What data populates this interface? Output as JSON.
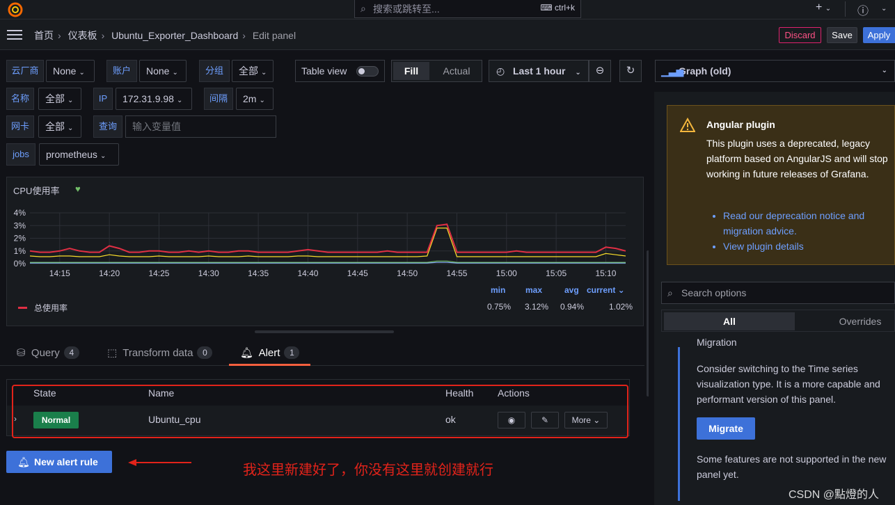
{
  "topbar": {
    "search_placeholder": "搜索或跳转至...",
    "search_shortcut": "ctrl+k",
    "plus_icon": "plus-icon",
    "help_icon": "help-icon"
  },
  "breadcrumb": [
    "首页",
    "仪表板",
    "Ubuntu_Exporter_Dashboard",
    "Edit panel"
  ],
  "actions": {
    "discard": "Discard",
    "save": "Save",
    "apply": "Apply"
  },
  "variables": {
    "cloud": {
      "label": "云厂商",
      "value": "None"
    },
    "account": {
      "label": "账户",
      "value": "None"
    },
    "group": {
      "label": "分组",
      "value": "全部"
    },
    "name": {
      "label": "名称",
      "value": "全部"
    },
    "ip": {
      "label": "IP",
      "value": "172.31.9.98"
    },
    "interval": {
      "label": "间隔",
      "value": "2m"
    },
    "nic": {
      "label": "网卡",
      "value": "全部"
    },
    "query": {
      "label": "查询",
      "placeholder": "输入变量值"
    },
    "jobs": {
      "label": "jobs",
      "value": "prometheus"
    }
  },
  "controls": {
    "table_view": "Table view",
    "fill": "Fill",
    "actual": "Actual",
    "time_range": "Last 1 hour"
  },
  "panel": {
    "title": "CPU使用率",
    "legend_headers": [
      "min",
      "max",
      "avg",
      "current"
    ],
    "legend_series": "总使用率",
    "legend_values": [
      "0.75%",
      "3.12%",
      "0.94%",
      "1.02%"
    ]
  },
  "chart_data": {
    "type": "line",
    "title": "CPU使用率",
    "x": [
      "14:12",
      "14:13",
      "14:14",
      "14:15",
      "14:16",
      "14:17",
      "14:18",
      "14:19",
      "14:20",
      "14:21",
      "14:22",
      "14:23",
      "14:24",
      "14:25",
      "14:26",
      "14:27",
      "14:28",
      "14:29",
      "14:30",
      "14:31",
      "14:32",
      "14:33",
      "14:34",
      "14:35",
      "14:36",
      "14:37",
      "14:38",
      "14:39",
      "14:40",
      "14:41",
      "14:42",
      "14:43",
      "14:44",
      "14:45",
      "14:46",
      "14:47",
      "14:48",
      "14:49",
      "14:50",
      "14:51",
      "14:52",
      "14:53",
      "14:54",
      "14:55",
      "14:56",
      "14:57",
      "14:58",
      "14:59",
      "15:00",
      "15:01",
      "15:02",
      "15:03",
      "15:04",
      "15:05",
      "15:06",
      "15:07",
      "15:08",
      "15:09",
      "15:10",
      "15:11",
      "15:12"
    ],
    "x_ticks": [
      "14:15",
      "14:20",
      "14:25",
      "14:30",
      "14:35",
      "14:40",
      "14:45",
      "14:50",
      "14:55",
      "15:00",
      "15:05",
      "15:10"
    ],
    "y_ticks": [
      "0%",
      "1%",
      "2%",
      "3%",
      "4%"
    ],
    "ylim": [
      0,
      4
    ],
    "series": [
      {
        "name": "总使用率",
        "color": "#e02f44",
        "values": [
          1.0,
          0.9,
          0.9,
          1.0,
          1.2,
          1.0,
          0.9,
          0.9,
          1.4,
          1.2,
          0.9,
          0.9,
          1.0,
          1.0,
          0.9,
          0.9,
          1.0,
          0.9,
          1.0,
          0.9,
          0.9,
          1.0,
          1.0,
          0.9,
          0.9,
          0.9,
          0.9,
          1.0,
          1.1,
          1.0,
          0.9,
          0.9,
          0.9,
          0.9,
          0.9,
          0.9,
          1.0,
          0.9,
          0.9,
          0.9,
          0.9,
          3.0,
          3.1,
          0.9,
          0.9,
          0.9,
          0.9,
          0.9,
          0.9,
          1.0,
          0.9,
          0.9,
          0.9,
          0.9,
          0.9,
          0.9,
          0.9,
          0.9,
          1.3,
          1.2,
          1.0
        ]
      },
      {
        "color": "#fade2a",
        "values": [
          0.6,
          0.55,
          0.55,
          0.6,
          0.6,
          0.55,
          0.55,
          0.55,
          0.7,
          0.6,
          0.55,
          0.55,
          0.55,
          0.6,
          0.55,
          0.55,
          0.55,
          0.55,
          0.6,
          0.55,
          0.55,
          0.55,
          0.6,
          0.55,
          0.55,
          0.55,
          0.55,
          0.6,
          0.6,
          0.55,
          0.55,
          0.55,
          0.55,
          0.55,
          0.55,
          0.55,
          0.55,
          0.55,
          0.55,
          0.55,
          0.6,
          2.8,
          2.8,
          0.55,
          0.55,
          0.55,
          0.55,
          0.55,
          0.55,
          0.55,
          0.55,
          0.55,
          0.55,
          0.55,
          0.55,
          0.55,
          0.55,
          0.55,
          0.8,
          0.7,
          0.6
        ]
      },
      {
        "color": "#73bf69",
        "values": [
          0.1,
          0.1,
          0.1,
          0.1,
          0.1,
          0.1,
          0.1,
          0.1,
          0.1,
          0.1,
          0.1,
          0.1,
          0.1,
          0.1,
          0.1,
          0.1,
          0.1,
          0.1,
          0.1,
          0.1,
          0.1,
          0.1,
          0.1,
          0.1,
          0.1,
          0.1,
          0.1,
          0.1,
          0.1,
          0.1,
          0.1,
          0.1,
          0.1,
          0.1,
          0.1,
          0.1,
          0.1,
          0.1,
          0.1,
          0.1,
          0.1,
          0.2,
          0.2,
          0.1,
          0.1,
          0.1,
          0.1,
          0.1,
          0.1,
          0.1,
          0.1,
          0.1,
          0.1,
          0.1,
          0.1,
          0.1,
          0.1,
          0.1,
          0.1,
          0.1,
          0.1
        ]
      },
      {
        "color": "#8ab8ff",
        "values": [
          0.05,
          0.05,
          0.05,
          0.05,
          0.05,
          0.05,
          0.05,
          0.05,
          0.05,
          0.05,
          0.05,
          0.05,
          0.05,
          0.05,
          0.05,
          0.05,
          0.05,
          0.05,
          0.05,
          0.05,
          0.05,
          0.05,
          0.05,
          0.05,
          0.05,
          0.05,
          0.05,
          0.05,
          0.05,
          0.05,
          0.05,
          0.05,
          0.05,
          0.05,
          0.05,
          0.05,
          0.05,
          0.05,
          0.05,
          0.05,
          0.05,
          0.1,
          0.1,
          0.05,
          0.05,
          0.05,
          0.05,
          0.05,
          0.05,
          0.05,
          0.05,
          0.05,
          0.05,
          0.05,
          0.05,
          0.05,
          0.05,
          0.05,
          0.05,
          0.05,
          0.05
        ]
      }
    ]
  },
  "tabs": [
    {
      "label": "Query",
      "count": "4"
    },
    {
      "label": "Transform data",
      "count": "0"
    },
    {
      "label": "Alert",
      "count": "1"
    }
  ],
  "alerts": {
    "headers": {
      "state": "State",
      "name": "Name",
      "health": "Health",
      "actions": "Actions"
    },
    "row": {
      "state": "Normal",
      "name": "Ubuntu_cpu",
      "health": "ok",
      "more": "More"
    },
    "new_rule": "New alert rule"
  },
  "annotation": "我这里新建好了，你没有这里就创建就行",
  "options": {
    "viz": "Graph (old)",
    "warning_title": "Angular plugin",
    "warning_text": "This plugin uses a deprecated, legacy platform based on AngularJS and will stop working in future releases of Grafana.",
    "link1": "Read our deprecation notice and migration advice.",
    "link2": "View plugin details",
    "search_placeholder": "Search options",
    "tab_all": "All",
    "tab_overrides": "Overrides",
    "migration_title": "Migration",
    "migration_text": "Consider switching to the Time series visualization type. It is a more capable and performant version of this panel.",
    "migrate_btn": "Migrate",
    "unsupported": "Some features are not supported in the new panel yet."
  },
  "watermark": "CSDN @點燈的人",
  "colors": {
    "accent": "#3d71d9",
    "alert_tab": "#f55f3e",
    "normal": "#1a7f4b",
    "annotation": "#e2231a"
  }
}
